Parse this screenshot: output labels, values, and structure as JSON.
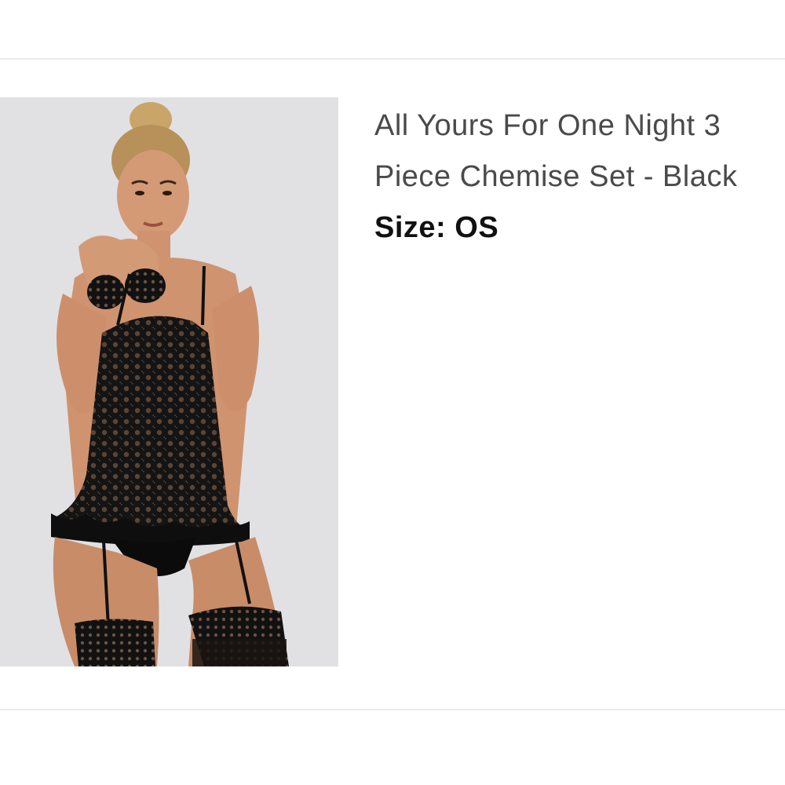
{
  "product": {
    "title": "All Yours For One Night 3 Piece Chemise Set - Black",
    "size_label": "Size:",
    "size_value": "OS",
    "image_icon": "product-photo"
  },
  "colors": {
    "image_background": "#e1e1e3",
    "title_text": "#4a4a4a",
    "size_text": "#111111",
    "divider": "#ececec"
  }
}
